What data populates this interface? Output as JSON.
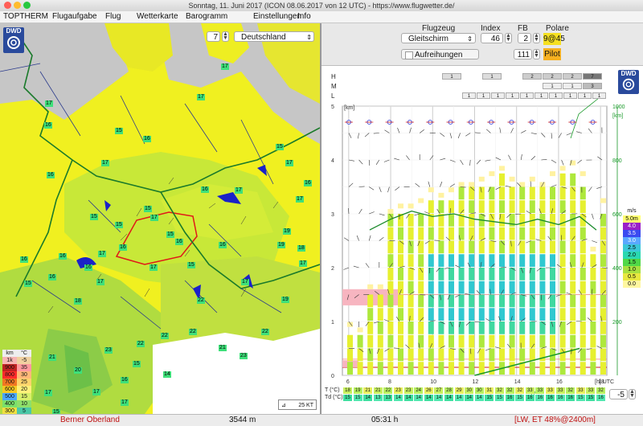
{
  "window": {
    "title": "Sonntag, 11. Juni 2017 (ICON 08.06.2017 von 12 UTC) - https://www.flugwetter.de/"
  },
  "menu": [
    "TOPTHERM",
    "Flugaufgabe",
    "Flug",
    "Wetterkarte",
    "Barogramm",
    "Einstellungen",
    "Info"
  ],
  "map": {
    "logo": "DWD",
    "zoom_value": "7",
    "region_select": "Deutschland",
    "scale_label": "25 KT",
    "thermal_labels": [
      "17",
      "17",
      "17",
      "16",
      "15",
      "16",
      "17",
      "16",
      "15",
      "15",
      "15",
      "17",
      "15",
      "16",
      "16",
      "17",
      "16",
      "16",
      "16",
      "17",
      "15",
      "17",
      "16",
      "17",
      "19",
      "19",
      "18",
      "17",
      "16",
      "15",
      "16",
      "17",
      "18",
      "17",
      "15",
      "16",
      "17",
      "19",
      "22",
      "22",
      "22",
      "22",
      "23",
      "22",
      "21",
      "23",
      "20",
      "17",
      "16",
      "17",
      "15",
      "17",
      "14",
      "15",
      "16",
      "21"
    ],
    "legend": {
      "head": [
        "km",
        "°C"
      ],
      "rows": [
        {
          "km": "1k",
          "c": "-5",
          "bg": "#f7b3b3",
          "bg2": "#f0d0a0"
        },
        {
          "km": "900",
          "c": "35",
          "bg": "#c22222",
          "bg2": "#ff9aa0"
        },
        {
          "km": "800",
          "c": "30",
          "bg": "#ff2a2a",
          "bg2": "#ffb878"
        },
        {
          "km": "700",
          "c": "25",
          "bg": "#f07722",
          "bg2": "#ffd46c"
        },
        {
          "km": "600",
          "c": "20",
          "bg": "#f5c822",
          "bg2": "#fff07a"
        },
        {
          "km": "500",
          "c": "15",
          "bg": "#4aa8ff",
          "bg2": "#d8f06a"
        },
        {
          "km": "400",
          "c": "10",
          "bg": "#7ae06a",
          "bg2": "#8ee06a"
        },
        {
          "km": "300",
          "c": "5",
          "bg": "#f0e040",
          "bg2": "#4ac8a8"
        },
        {
          "km": "200",
          "c": "0",
          "bg": "#ff9a30",
          "bg2": "#4a8cff"
        },
        {
          "km": "100",
          "c": "-5",
          "bg": "#ffcce0",
          "bg2": "#a040e0"
        },
        {
          "km": "0",
          "c": "-10",
          "bg": "#ffffff",
          "bg2": "#7030a0"
        }
      ]
    }
  },
  "controls": {
    "flugzeug_label": "Flugzeug",
    "flugzeug_value": "Gleitschirm",
    "index_label": "Index",
    "index_value": "46",
    "fb_label": "FB",
    "fb_value": "2",
    "polare_label": "Polare",
    "polare_value": "9@45",
    "aufreihungen_label": "Aufreihungen",
    "pilot_value": "111",
    "pilot_label": "Pilot"
  },
  "panel": {
    "logo": "DWD",
    "cloud_layers": [
      "H",
      "M",
      "L"
    ],
    "cloud_h_values": [
      "1",
      "1",
      "2",
      "2",
      "2",
      "7"
    ],
    "cloud_m_values": [
      "1",
      "1",
      "3"
    ],
    "cloud_l_values": [
      "1",
      "1",
      "1",
      "1",
      "1",
      "1",
      "1",
      "1",
      "1",
      "1"
    ],
    "y_left_unit": "[km]",
    "y_left_ticks": [
      "5",
      "4",
      "3",
      "2",
      "1",
      "0"
    ],
    "y_right_unit": "[km]",
    "y_right_ticks": [
      "1000",
      "800",
      "600",
      "400",
      "200"
    ],
    "x_ticks": [
      "6",
      "8",
      "10",
      "12",
      "14",
      "16",
      "18"
    ],
    "x_unit": "[h] UTC",
    "climb_legend_title": "m/s",
    "climb_legend": [
      {
        "label": "5.0m",
        "color": "#ffff70"
      },
      {
        "label": "4.0",
        "color": "#9a20c8"
      },
      {
        "label": "3.5",
        "color": "#3a4af0"
      },
      {
        "label": "3.0",
        "color": "#5aa8ff"
      },
      {
        "label": "2.5",
        "color": "#3ac8d8"
      },
      {
        "label": "2.0",
        "color": "#2ad8b0"
      },
      {
        "label": "1.5",
        "color": "#50d848"
      },
      {
        "label": "1.0",
        "color": "#a8e040"
      },
      {
        "label": "0.5",
        "color": "#e8e840"
      },
      {
        "label": "0.0",
        "color": "#fff7a0"
      }
    ],
    "temp_row_label": "T  (°C)",
    "dew_row_label": "Td (°C)",
    "temp_values": [
      "18",
      "19",
      "21",
      "21",
      "22",
      "23",
      "23",
      "24",
      "26",
      "27",
      "28",
      "29",
      "30",
      "30",
      "31",
      "32",
      "32",
      "32",
      "33",
      "33",
      "33",
      "33",
      "32",
      "33",
      "33",
      "32"
    ],
    "dew_values": [
      "15",
      "15",
      "14",
      "13",
      "13",
      "14",
      "14",
      "14",
      "14",
      "14",
      "14",
      "14",
      "14",
      "14",
      "15",
      "15",
      "16",
      "15",
      "16",
      "16",
      "16",
      "16",
      "16",
      "15",
      "15",
      "16"
    ],
    "stepper_value": "-5"
  },
  "status": {
    "region": "Berner Oberland",
    "altitude": "3544 m",
    "duration": "05:31 h",
    "rating": "[LW, ET  48%@2400m]"
  }
}
